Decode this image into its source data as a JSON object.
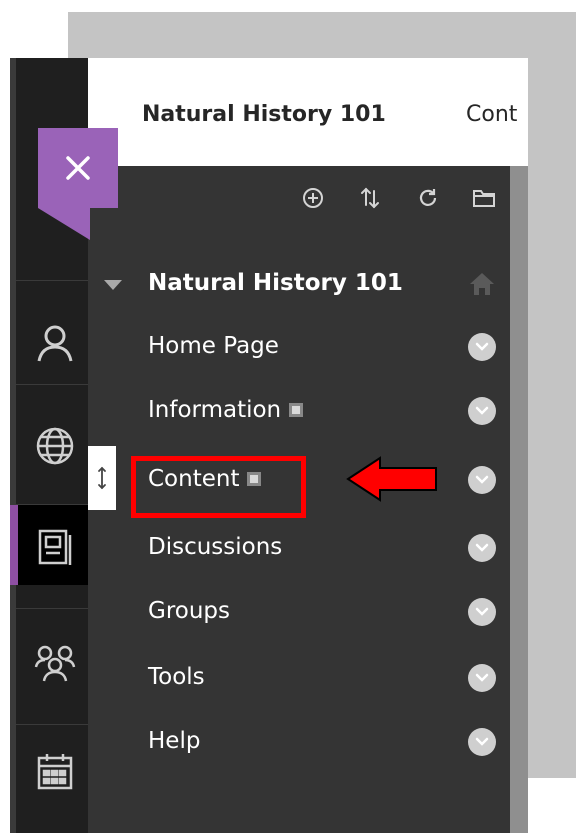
{
  "header": {
    "course_title": "Natural History 101",
    "truncated_tab": "Cont"
  },
  "panel": {
    "title": "Natural History 101",
    "items": [
      {
        "label": "Home Page",
        "hidden": false
      },
      {
        "label": "Information",
        "hidden": true
      },
      {
        "label": "Content",
        "hidden": true
      },
      {
        "label": "Discussions",
        "hidden": false
      },
      {
        "label": "Groups",
        "hidden": false
      },
      {
        "label": "Tools",
        "hidden": false
      },
      {
        "label": "Help",
        "hidden": false
      }
    ]
  },
  "icons": {
    "close": "close-icon",
    "toolbar": [
      "add-icon",
      "reorder-icon",
      "refresh-icon",
      "folder-icon"
    ],
    "rail": [
      "user-icon",
      "globe-icon",
      "courses-icon",
      "groups-icon",
      "calendar-icon"
    ]
  },
  "colors": {
    "accent": "#9a63b8",
    "highlight": "#ff0000",
    "panel": "#343434"
  }
}
